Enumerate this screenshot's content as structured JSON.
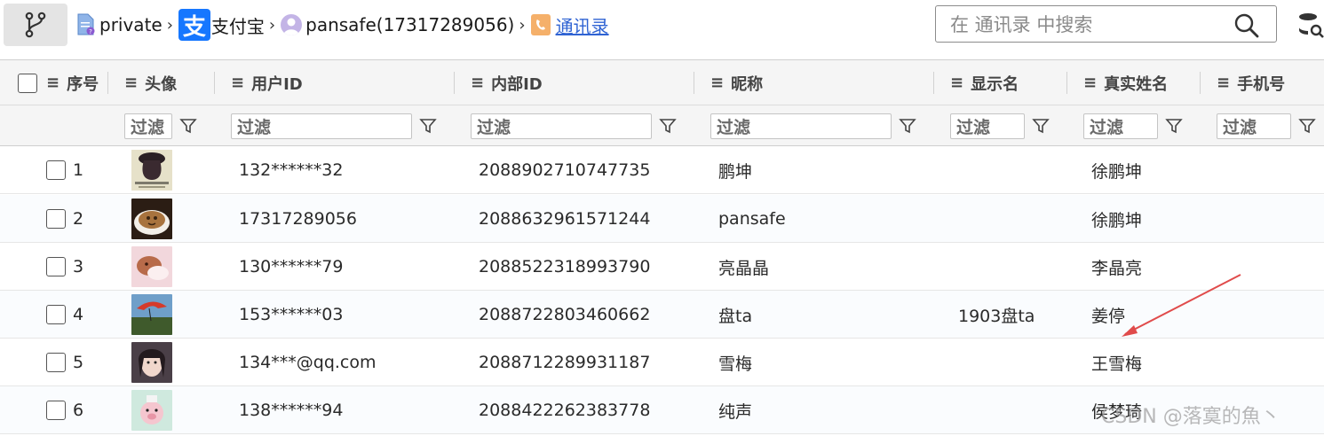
{
  "breadcrumb": {
    "items": [
      {
        "label": "private",
        "icon": "file-icon"
      },
      {
        "label": "支付宝",
        "icon": "alipay-icon",
        "icon_glyph": "支"
      },
      {
        "label": "pansafe(17317289056)",
        "icon": "user-icon"
      },
      {
        "label": "通讯录",
        "icon": "contacts-icon"
      }
    ]
  },
  "search": {
    "placeholder": "在 通讯录 中搜索"
  },
  "columns": [
    "序号",
    "头像",
    "用户ID",
    "内部ID",
    "昵称",
    "显示名",
    "真实姓名",
    "手机号"
  ],
  "filter_placeholder": "过滤",
  "rows": [
    {
      "index": "1",
      "user_id": "132******32",
      "internal_id": "2088902710747735",
      "nickname": "鹏坤",
      "display_name": "",
      "real_name": "徐鹏坤",
      "phone": ""
    },
    {
      "index": "2",
      "user_id": "17317289056",
      "internal_id": "2088632961571244",
      "nickname": "pansafe",
      "display_name": "",
      "real_name": "徐鹏坤",
      "phone": ""
    },
    {
      "index": "3",
      "user_id": "130******79",
      "internal_id": "2088522318993790",
      "nickname": "亮晶晶",
      "display_name": "",
      "real_name": "李晶亮",
      "phone": ""
    },
    {
      "index": "4",
      "user_id": "153******03",
      "internal_id": "2088722803460662",
      "nickname": "盘ta",
      "display_name": "1903盘ta",
      "real_name": "姜停",
      "phone": ""
    },
    {
      "index": "5",
      "user_id": "134***@qq.com",
      "internal_id": "2088712289931187",
      "nickname": "雪梅",
      "display_name": "",
      "real_name": "王雪梅",
      "phone": ""
    },
    {
      "index": "6",
      "user_id": "138******94",
      "internal_id": "2088422262383778",
      "nickname": "纯声",
      "display_name": "",
      "real_name": "侯梦琦",
      "phone": ""
    }
  ],
  "watermark": "CSDN @落寞的魚丶",
  "colors": {
    "accent": "#1677ff",
    "link": "#2f63d3",
    "arrow": "#e04b4b"
  }
}
